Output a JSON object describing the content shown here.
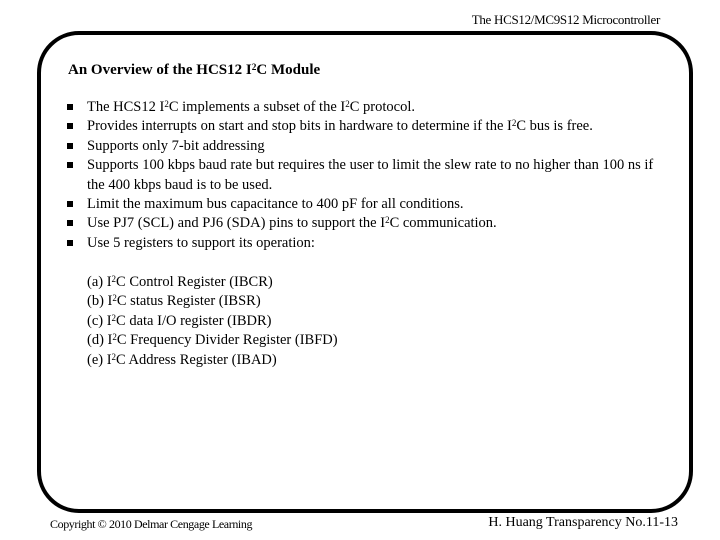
{
  "header": {
    "course_title": "The HCS12/MC9S12 Microcontroller"
  },
  "slide": {
    "title_prefix": "An Overview of the HCS12 I",
    "title_sup": "2",
    "title_suffix": "C Module",
    "bullets": [
      {
        "parts": [
          {
            "t": "The HCS12 I"
          },
          {
            "s": "2"
          },
          {
            "t": "C implements a subset of the I"
          },
          {
            "s": "2"
          },
          {
            "t": "C protocol."
          }
        ]
      },
      {
        "parts": [
          {
            "t": "Provides interrupts on start and stop bits in hardware to determine if the I"
          },
          {
            "s": "2"
          },
          {
            "t": "C bus is free."
          }
        ]
      },
      {
        "parts": [
          {
            "t": "Supports only 7-bit addressing"
          }
        ]
      },
      {
        "parts": [
          {
            "t": "Supports 100 kbps baud rate but requires the user to limit the slew rate to no higher than 100 ns if the 400 kbps baud is to be used."
          }
        ]
      },
      {
        "parts": [
          {
            "t": "Limit the maximum bus capacitance to 400 pF for all conditions."
          }
        ]
      },
      {
        "parts": [
          {
            "t": "Use PJ7 (SCL) and PJ6 (SDA) pins to support the I"
          },
          {
            "s": "2"
          },
          {
            "t": "C communication."
          }
        ]
      },
      {
        "parts": [
          {
            "t": "Use 5 registers to support its operation:"
          }
        ]
      }
    ],
    "registers": [
      {
        "prefix": "(a) I",
        "sup": "2",
        "suffix": "C Control Register (IBCR)"
      },
      {
        "prefix": "(b) I",
        "sup": "2",
        "suffix": "C status Register (IBSR)"
      },
      {
        "prefix": "(c) I",
        "sup": "2",
        "suffix": "C data I/O register (IBDR)"
      },
      {
        "prefix": "(d) I",
        "sup": "2",
        "suffix": "C Frequency Divider Register (IBFD)"
      },
      {
        "prefix": "(e) I",
        "sup": "2",
        "suffix": "C Address Register (IBAD)"
      }
    ]
  },
  "footer": {
    "copyright": "Copyright © 2010 Delmar Cengage Learning",
    "transparency": "H. Huang Transparency No.11-13"
  }
}
